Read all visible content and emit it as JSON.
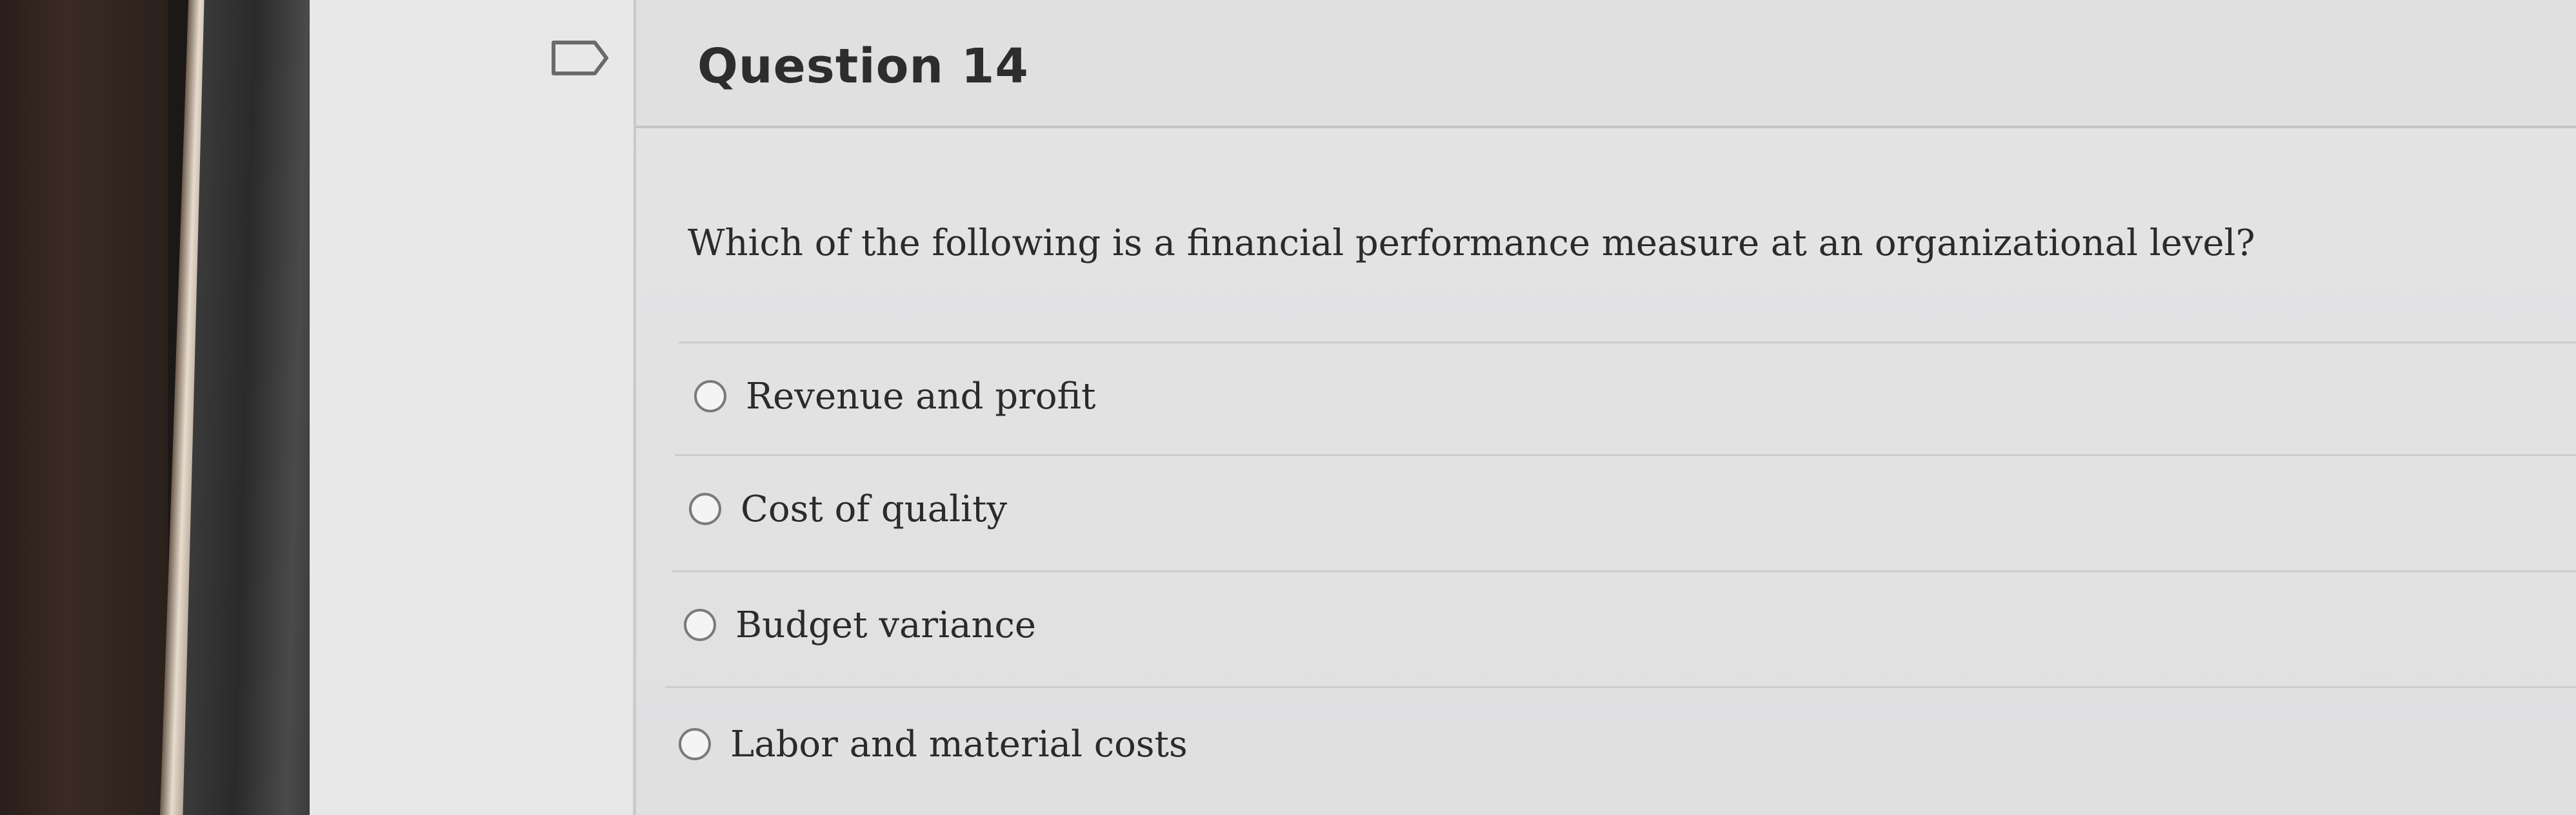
{
  "question": {
    "title": "Question 14",
    "text": "Which of the following is a financial performance measure at an organizational level?",
    "flag_icon": "flag-outline-icon"
  },
  "options": [
    {
      "label": "Revenue and profit",
      "selected": false
    },
    {
      "label": "Cost of quality",
      "selected": false
    },
    {
      "label": "Budget variance",
      "selected": false
    },
    {
      "label": "Labor and material costs",
      "selected": false
    }
  ],
  "colors": {
    "text": "#2b2b2b",
    "title": "#2d2d2d",
    "card_background": "#e0e0e1",
    "divider": "#cdcdcd",
    "radio_border": "#7a7a7a"
  }
}
